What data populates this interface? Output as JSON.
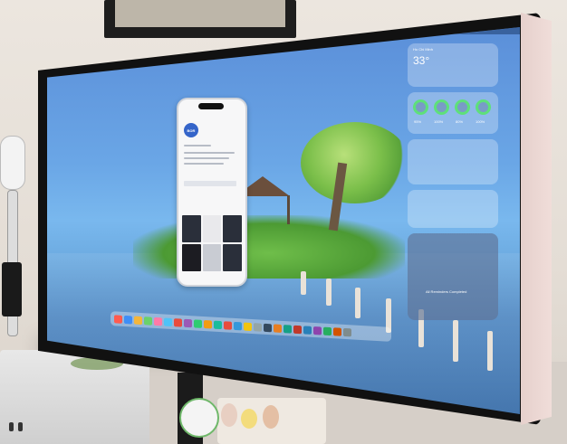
{
  "scene": {
    "description_tags": [
      "desk-setup",
      "external-display",
      "mac-mini"
    ]
  },
  "phone_mirroring": {
    "avatar_text": "BOR"
  },
  "widgets": {
    "weather": {
      "city": "Ho Chi Minh",
      "temperature": "33°"
    },
    "battery": {
      "levels": [
        "95%",
        "100%",
        "80%",
        "100%"
      ]
    },
    "reminders": {
      "text": "All Reminders Completed"
    }
  },
  "dock": {
    "icon_colors": [
      "#ff5b4f",
      "#3e8ef7",
      "#f4b63a",
      "#6bd16b",
      "#ff7aa8",
      "#4fc3f7",
      "#e84c3d",
      "#9b59b6",
      "#2ecc71",
      "#f39c12",
      "#1abc9c",
      "#e74c3c",
      "#3498db",
      "#f1c40f",
      "#95a5a6",
      "#34495e",
      "#e67e22",
      "#16a085",
      "#c0392b",
      "#2980b9",
      "#8e44ad",
      "#27ae60",
      "#d35400",
      "#7f8c8d"
    ]
  }
}
